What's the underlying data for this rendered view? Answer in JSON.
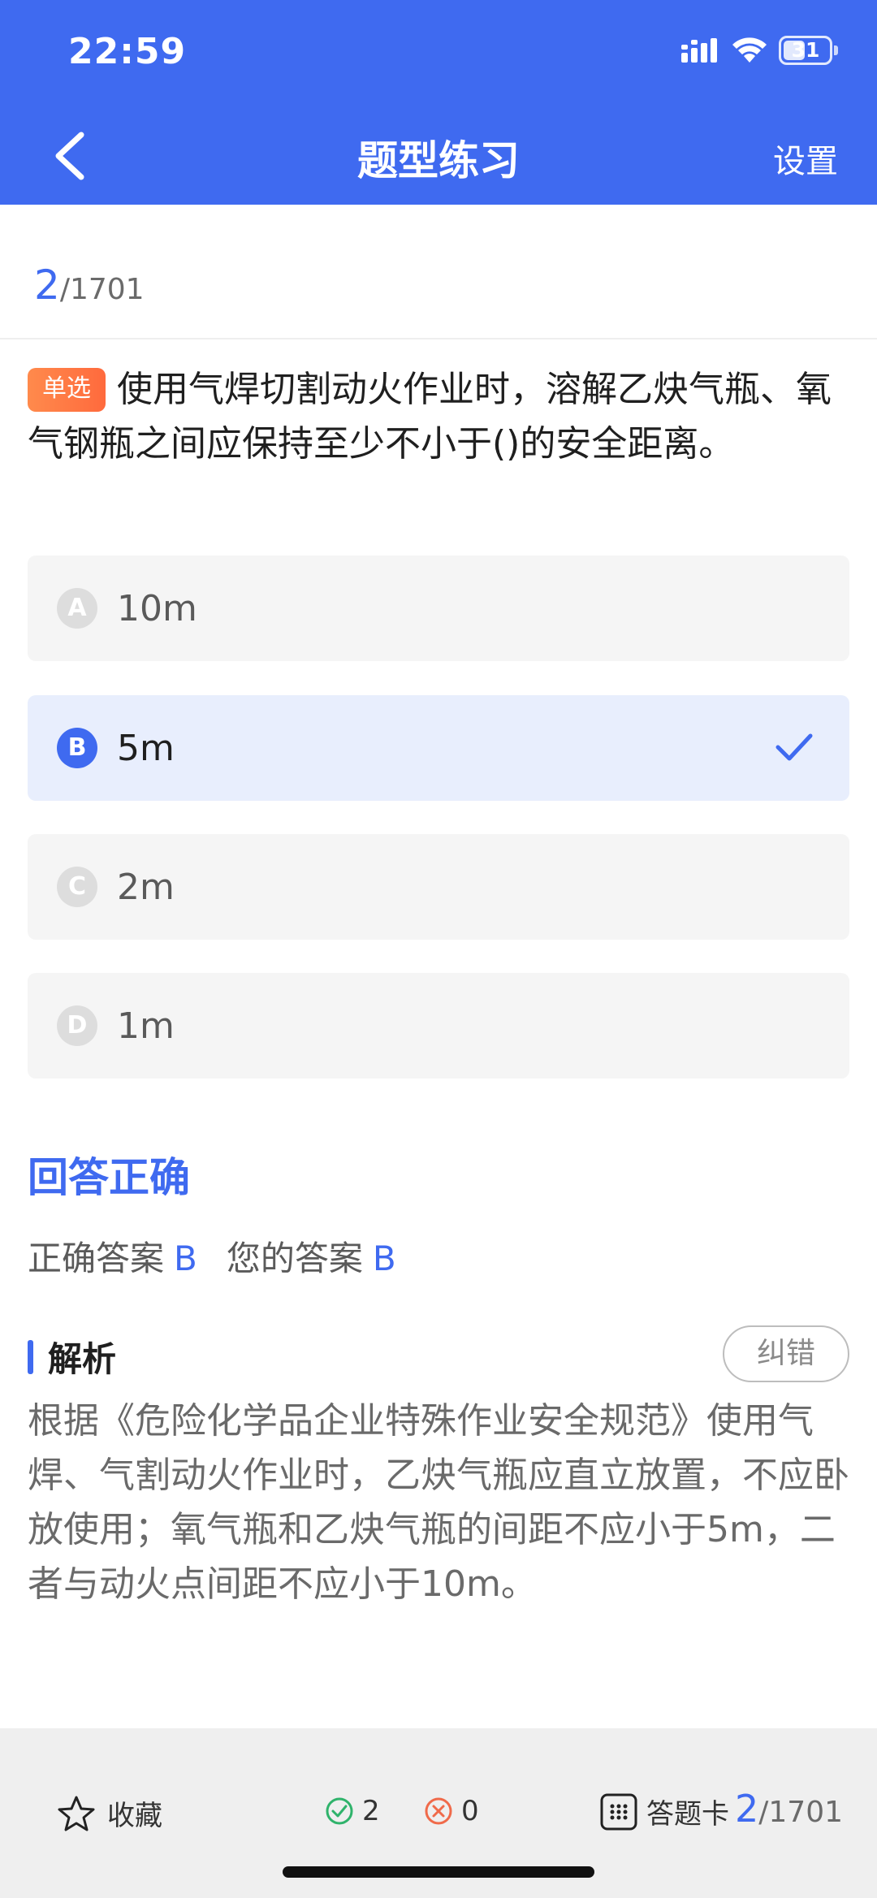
{
  "status_bar": {
    "time": "22:59",
    "battery": "31"
  },
  "nav": {
    "title": "题型练习",
    "settings": "设置"
  },
  "progress": {
    "current": "2",
    "total": "/1701"
  },
  "question": {
    "type_badge": "单选",
    "text": "使用气焊切割动火作业时，溶解乙炔气瓶、氧气钢瓶之间应保持至少不小于()的安全距离。"
  },
  "options": [
    {
      "letter": "A",
      "text": "10m",
      "selected": false
    },
    {
      "letter": "B",
      "text": "5m",
      "selected": true
    },
    {
      "letter": "C",
      "text": "2m",
      "selected": false
    },
    {
      "letter": "D",
      "text": "1m",
      "selected": false
    }
  ],
  "result": {
    "title": "回答正确",
    "correct_label": "正确答案",
    "correct_value": "B",
    "yours_label": "您的答案",
    "yours_value": "B"
  },
  "analysis": {
    "title": "解析",
    "report_button": "纠错",
    "text": "根据《危险化学品企业特殊作业安全规范》使用气焊、气割动火作业时，乙炔气瓶应直立放置，不应卧放使用；氧气瓶和乙炔气瓶的间距不应小于5m，二者与动火点间距不应小于10m。"
  },
  "bottom_bar": {
    "favorite": "收藏",
    "correct_count": "2",
    "wrong_count": "0",
    "answer_card": "答题卡",
    "current": "2",
    "total": "/1701"
  },
  "colors": {
    "primary": "#3f6af0",
    "correct": "#2fb36b",
    "wrong": "#f06a4a",
    "badge": "#ff7a45"
  }
}
